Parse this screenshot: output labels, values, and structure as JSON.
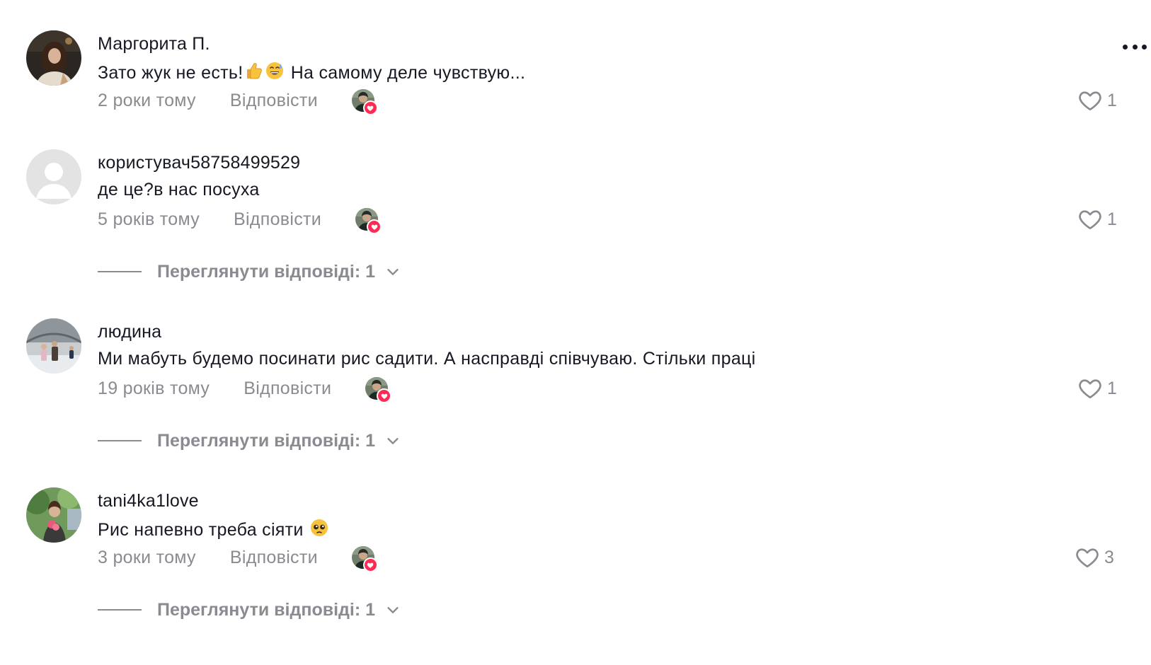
{
  "comments": [
    {
      "username": "Маргорита П.",
      "text_before": "Зато жук не есть!",
      "emojis": [
        "thumbs-up-emoji",
        "grinning-sweat-emoji"
      ],
      "text_after": " На самому деле чувствую...",
      "time": "2 роки тому",
      "reply_label": "Відповісти",
      "like_count": "1",
      "has_more_menu": true
    },
    {
      "username": "користувач58758499529",
      "text": "де це?в нас посуха",
      "time": "5 років тому",
      "reply_label": "Відповісти",
      "like_count": "1",
      "view_replies": "Переглянути відповіді: 1"
    },
    {
      "username": "людина",
      "text": "Ми мабуть будемо посинати рис садити. А насправді співчуваю. Стільки праці",
      "time": "19 років тому",
      "reply_label": "Відповісти",
      "like_count": "1",
      "view_replies": "Переглянути відповіді: 1"
    },
    {
      "username": "tani4ka1love",
      "text": "Рис напевно треба сіяти ",
      "emoji": "pleading-face-emoji",
      "time": "3 роки тому",
      "reply_label": "Відповісти",
      "like_count": "3",
      "view_replies": "Переглянути відповіді: 1"
    }
  ],
  "colors": {
    "primary_text": "#161823",
    "secondary_text": "#8a8b91",
    "heart_badge": "#fe2c55"
  },
  "icons": {
    "like": "heart-outline-icon",
    "more": "more-horizontal-icon",
    "expand": "chevron-down-icon",
    "creator_liked": "heart-badge-icon"
  }
}
